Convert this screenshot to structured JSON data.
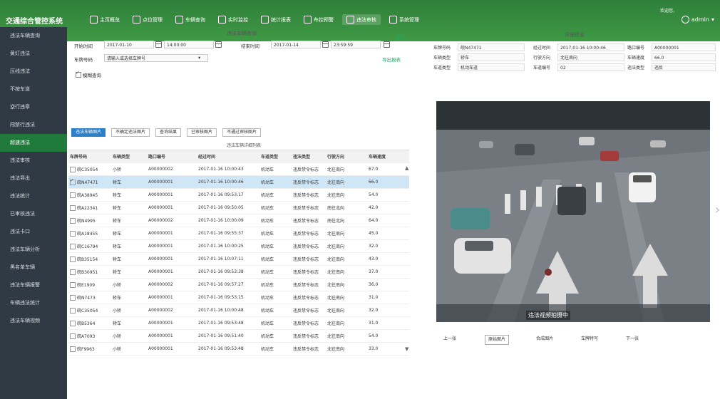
{
  "app_title": "交通综合管控系统",
  "nav": [
    {
      "icon": "home-icon",
      "label": "主页概览"
    },
    {
      "icon": "location-icon",
      "label": "点位管理"
    },
    {
      "icon": "car-icon",
      "label": "车辆查询"
    },
    {
      "icon": "monitor-icon",
      "label": "实时监控"
    },
    {
      "icon": "report-icon",
      "label": "统计报表"
    },
    {
      "icon": "flag-icon",
      "label": "布控预警"
    },
    {
      "icon": "chart-icon",
      "label": "违法审核"
    },
    {
      "icon": "gear-icon",
      "label": "系统管理"
    }
  ],
  "nav_active": 6,
  "user_status": "欢迎您，",
  "admin_label": "admin",
  "sidebar": [
    "违法车辆查询",
    "黄灯违法",
    "压线违法",
    "不按车道",
    "逆行违章",
    "闯禁行违法",
    "超速违法",
    "违法审核",
    "违法导出",
    "违法统计",
    "已审核违法",
    "违法卡口",
    "违法车辆分析",
    "黑名单车辆",
    "违法车辆报警",
    "车辆违法统计",
    "违法车辆视频"
  ],
  "sidebar_active": 6,
  "search": {
    "title": "违法车辆查询",
    "start_label": "开始时间",
    "start_date": "2017-01-10",
    "start_time": "14:00:00",
    "end_label": "结束时间",
    "end_date": "2017-01-14",
    "end_time": "23:59:59",
    "query_label": "查询",
    "plate_label": "车牌号码",
    "plate_value": "请输入或选择车牌号",
    "export_label": "导出报表",
    "checkbox_label": "模糊查询"
  },
  "tabs": [
    "违法车辆图片",
    "不确定违法图片",
    "查询结果",
    "已审核图片",
    "不通过审核图片"
  ],
  "tab_active": 0,
  "table_title": "违法车辆详细列表",
  "table": {
    "columns": [
      "车牌号码",
      "车辆类型",
      "路口编号",
      "经过时间",
      "车道类型",
      "违法类型",
      "行驶方向",
      "车辆速度"
    ],
    "rows": [
      [
        "皖C35054",
        "小轿",
        "A00000002",
        "2017-01-16 10:00:43",
        "机动车",
        "违反禁令标志",
        "北往南向",
        "67.0"
      ],
      [
        "皖N47471",
        "轿车",
        "A00000001",
        "2017-01-16 10:00:46",
        "机动车",
        "违反禁令标志",
        "北往南向",
        "66.0"
      ],
      [
        "皖A38945",
        "轿车",
        "A00000001",
        "2017-01-16 09:53:17",
        "机动车",
        "违反禁令标志",
        "北往南向",
        "54.0"
      ],
      [
        "皖A22341",
        "轿车",
        "A00000001",
        "2017-01-16 09:50:05",
        "机动车",
        "违反禁令标志",
        "南往北向",
        "42.0"
      ],
      [
        "皖N4995",
        "轿车",
        "A00000002",
        "2017-01-16 10:00:09",
        "机动车",
        "违反禁令标志",
        "南往北向",
        "64.0"
      ],
      [
        "皖A18455",
        "轿车",
        "A00000001",
        "2017-01-16 09:55:37",
        "机动车",
        "违反禁令标志",
        "北往南向",
        "45.0"
      ],
      [
        "皖C16794",
        "轿车",
        "A00000001",
        "2017-01-16 10:00:25",
        "机动车",
        "违反禁令标志",
        "北往南向",
        "32.0"
      ],
      [
        "皖B35154",
        "轿车",
        "A00000001",
        "2017-01-16 10:07:11",
        "机动车",
        "违反禁令标志",
        "北往南向",
        "43.0"
      ],
      [
        "皖B30951",
        "轿车",
        "A00000001",
        "2017-01-16 09:53:38",
        "机动车",
        "违反禁令标志",
        "北往南向",
        "37.0"
      ],
      [
        "皖E1909",
        "小轿",
        "A00000002",
        "2017-01-16 09:57:27",
        "机动车",
        "违反禁令标志",
        "北往南向",
        "36.0"
      ],
      [
        "皖N7473",
        "轿车",
        "A00000001",
        "2017-01-16 09:53:15",
        "机动车",
        "违反禁令标志",
        "北往南向",
        "31.0"
      ],
      [
        "皖C35054",
        "小轿",
        "A00000002",
        "2017-01-16 10:00:48",
        "机动车",
        "违反禁令标志",
        "北往南向",
        "32.0"
      ],
      [
        "皖B5364",
        "轿车",
        "A00000001",
        "2017-01-16 09:53:48",
        "机动车",
        "违反禁令标志",
        "北往南向",
        "31.0"
      ],
      [
        "皖A7093",
        "小轿",
        "A00000001",
        "2017-01-16 09:51:40",
        "机动车",
        "违反禁令标志",
        "北往南向",
        "54.0"
      ],
      [
        "皖F9963",
        "小轿",
        "A00000001",
        "2017-01-16 09:53:48",
        "机动车",
        "违反禁令标志",
        "北往南向",
        "33.0"
      ]
    ],
    "selected_row": 1
  },
  "detail": {
    "title": "详细信息",
    "fields": [
      {
        "label": "车牌号码",
        "value": "皖N47471"
      },
      {
        "label": "经过时间",
        "value": "2017-01-16 10:00:46"
      },
      {
        "label": "路口编号",
        "value": "A00000001"
      },
      {
        "label": "车辆类型",
        "value": "轿车"
      },
      {
        "label": "行驶方向",
        "value": "北往南向"
      },
      {
        "label": "车辆速度",
        "value": "66.0"
      },
      {
        "label": "车道类型",
        "value": "机动车道"
      },
      {
        "label": "车道编号",
        "value": "02"
      },
      {
        "label": "违法类型",
        "value": "违反"
      }
    ]
  },
  "photo": {
    "caption": "违法视频拍摄中"
  },
  "photo_nav": {
    "prev": "上一张",
    "b1": "原始图片",
    "b2": "合成图片",
    "b3": "车牌特写",
    "next": "下一张"
  }
}
